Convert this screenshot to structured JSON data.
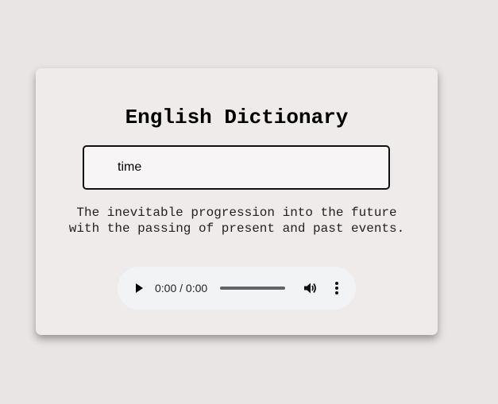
{
  "app": {
    "title": "English Dictionary"
  },
  "search": {
    "value": "time",
    "placeholder": ""
  },
  "result": {
    "definition": "The inevitable progression into the future with the passing of present and past events."
  },
  "audio": {
    "time": "0:00 / 0:00",
    "progress": 0,
    "icons": {
      "play": "play-icon",
      "volume": "volume-icon",
      "menu": "more-vertical-icon"
    }
  },
  "colors": {
    "background": "#e8e5e4",
    "card": "#efebea",
    "input_border": "#111111",
    "player_bg": "#f1f3f4"
  }
}
